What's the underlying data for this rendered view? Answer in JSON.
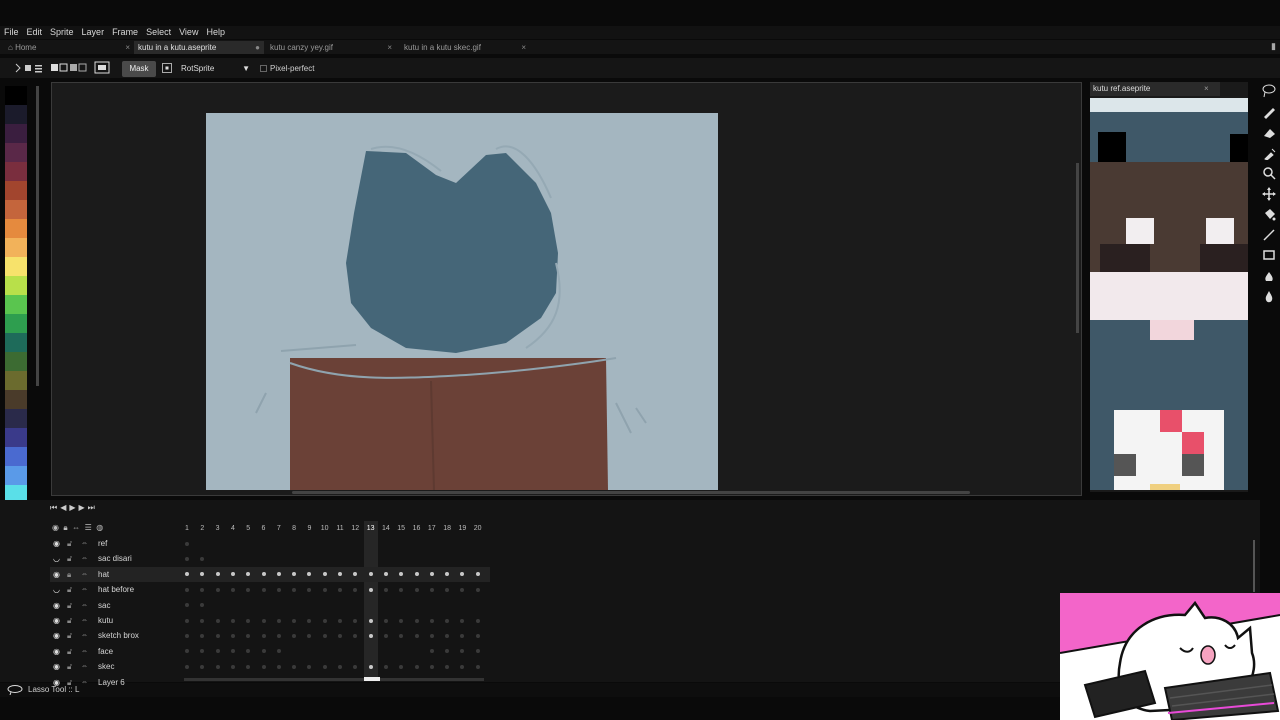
{
  "menu": [
    "File",
    "Edit",
    "Sprite",
    "Layer",
    "Frame",
    "Select",
    "View",
    "Help"
  ],
  "tabs": [
    {
      "label": "Home",
      "close": "×"
    },
    {
      "label": "kutu in a kutu.aseprite",
      "close": "●"
    },
    {
      "label": "kutu canzy yey.gif",
      "close": "×"
    },
    {
      "label": "kutu in a kutu skec.gif",
      "close": "×"
    }
  ],
  "toolbar": {
    "mask_label": "Mask",
    "rotation_algorithm": "RotSprite",
    "pixel_perfect_label": "Pixel-perfect",
    "pixel_perfect_checked": false
  },
  "palette": [
    "#000000",
    "#1b1b2b",
    "#3a1e3f",
    "#5a2848",
    "#7a2e3e",
    "#a2452e",
    "#c4653c",
    "#e58a3e",
    "#f2b25a",
    "#f7e26b",
    "#b8e04a",
    "#5ac54f",
    "#2e9e4f",
    "#1e6b5a",
    "#3c6b32",
    "#6b6b2e",
    "#4a3b2a",
    "#2a2a4a",
    "#3a3a8a",
    "#4a6ad0",
    "#5a9ae8",
    "#5adfe8",
    "#e8f0f0",
    "#f4f4f4"
  ],
  "colors": {
    "foreground_hex": "#456678",
    "background_hex": "#301f2a",
    "canvas_bg": "#a4b6c0",
    "hat": "#456678",
    "box": "#6b4137",
    "accent": "#f365c9"
  },
  "preview": {
    "title": "kutu ref.aseprite",
    "close": "×"
  },
  "tools": [
    "lasso-icon",
    "pencil-icon",
    "eraser-icon",
    "eyedropper-icon",
    "zoom-icon",
    "move-icon",
    "bucket-icon",
    "line-icon",
    "rectangle-icon",
    "blur-icon",
    "drop-icon"
  ],
  "timeline": {
    "controls": [
      "⏮",
      "◀",
      "▶",
      "▶",
      "⏭"
    ],
    "frames": [
      1,
      2,
      3,
      4,
      5,
      6,
      7,
      8,
      9,
      10,
      11,
      12,
      13,
      14,
      15,
      16,
      17,
      18,
      19,
      20
    ],
    "current_frame": 13,
    "layers": [
      {
        "name": "ref",
        "visible": true,
        "cels": [
          1
        ]
      },
      {
        "name": "sac disari",
        "visible": false,
        "cels": [
          1,
          2
        ]
      },
      {
        "name": "hat",
        "visible": true,
        "selected": true,
        "cels": [
          1,
          2,
          3,
          4,
          5,
          6,
          7,
          8,
          9,
          10,
          11,
          12,
          13,
          14,
          15,
          16,
          17,
          18,
          19,
          20
        ],
        "active": [
          1,
          2,
          3,
          4,
          5,
          6,
          7,
          8,
          9,
          10,
          11,
          12,
          13,
          14,
          15,
          16,
          17,
          18,
          19,
          20
        ]
      },
      {
        "name": "hat before",
        "visible": false,
        "cels": [
          1,
          2,
          3,
          4,
          5,
          6,
          7,
          8,
          9,
          10,
          11,
          12,
          13,
          14,
          15,
          16,
          17,
          18,
          19,
          20
        ],
        "active": [
          13
        ]
      },
      {
        "name": "sac",
        "visible": true,
        "cels": [
          1,
          2
        ]
      },
      {
        "name": "kutu",
        "visible": true,
        "cels": [
          1,
          2,
          3,
          4,
          5,
          6,
          7,
          8,
          9,
          10,
          11,
          12,
          13,
          14,
          15,
          16,
          17,
          18,
          19,
          20
        ],
        "active": [
          13
        ]
      },
      {
        "name": "sketch brox",
        "visible": true,
        "cels": [
          1,
          2,
          3,
          4,
          5,
          6,
          7,
          8,
          9,
          10,
          11,
          12,
          13,
          14,
          15,
          16,
          17,
          18,
          19,
          20
        ],
        "active": [
          13
        ]
      },
      {
        "name": "face",
        "visible": true,
        "cels": [
          1,
          2,
          3,
          4,
          5,
          6,
          7,
          17,
          18,
          19,
          20
        ]
      },
      {
        "name": "skec",
        "visible": true,
        "cels": [
          1,
          2,
          3,
          4,
          5,
          6,
          7,
          8,
          9,
          10,
          11,
          12,
          13,
          14,
          15,
          16,
          17,
          18,
          19,
          20
        ],
        "active": [
          13
        ]
      },
      {
        "name": "Layer 6",
        "visible": true,
        "cels": []
      }
    ]
  },
  "status": {
    "text": "Lasso Tool :: L"
  }
}
